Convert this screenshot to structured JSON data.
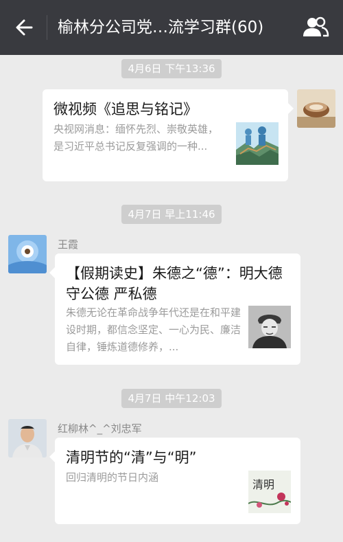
{
  "header": {
    "title": "榆林分公司党…流学习群(60)",
    "back_icon": "back-arrow-icon",
    "members_icon": "group-members-icon"
  },
  "messages": [
    {
      "timestamp": "4月6日 下午13:36",
      "from_self": true,
      "card": {
        "title": "微视频《追思与铭记》",
        "desc": "央视网消息：缅怀先烈、崇敬英雄，是习近平总书记反复强调的一种..."
      }
    },
    {
      "timestamp": "4月7日 早上11:46",
      "from_self": false,
      "sender": "王霞",
      "card": {
        "title": "【假期读史】朱德之“德”：明大德 守公德 严私德",
        "desc": "朱德无论在革命战争年代还是在和平建设时期，都信念坚定、一心为民、廉洁自律，锤炼道德修养，..."
      }
    },
    {
      "timestamp": "4月7日 中午12:03",
      "from_self": false,
      "sender": "红柳林^_^刘忠军",
      "card": {
        "title": "清明节的“清”与“明”",
        "desc": "回归清明的节日内涵"
      }
    }
  ],
  "thumbs": {
    "thumb_3_text": "清明"
  },
  "colors": {
    "topbar": "#393a3f",
    "background": "#ebebeb",
    "timestamp_bg": "#cecece",
    "card_bg": "#ffffff",
    "desc_text": "#9b9b9b"
  }
}
